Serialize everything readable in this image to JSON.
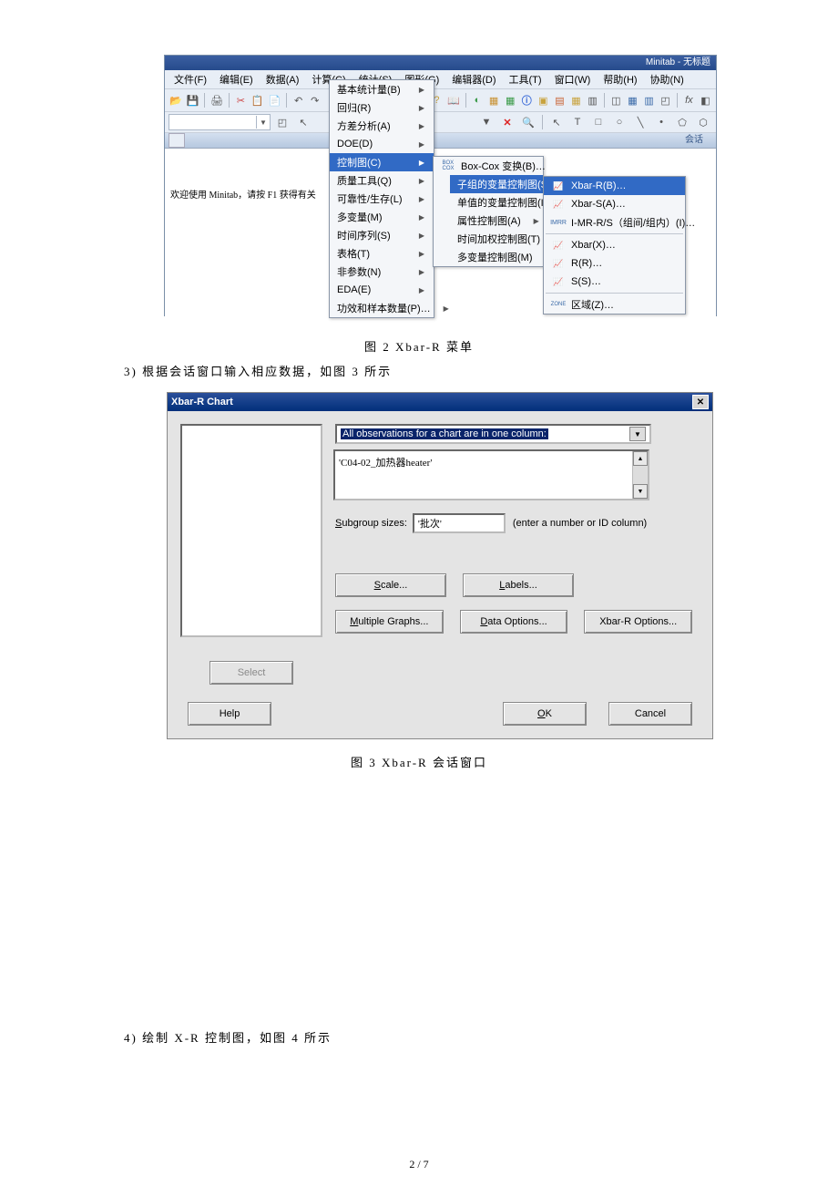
{
  "minitab": {
    "title": "Minitab - 无标题",
    "menubar": [
      "文件(F)",
      "编辑(E)",
      "数据(A)",
      "计算(C)",
      "统计(S)",
      "图形(G)",
      "编辑器(D)",
      "工具(T)",
      "窗口(W)",
      "帮助(H)",
      "协助(N)"
    ],
    "session_label": "会话",
    "welcome": "欢迎使用 Minitab，请按 F1 获得有关"
  },
  "stat_menu": {
    "items": [
      {
        "label": "基本统计量(B)",
        "arrow": true
      },
      {
        "label": "回归(R)",
        "arrow": true
      },
      {
        "label": "方差分析(A)",
        "arrow": true
      },
      {
        "label": "DOE(D)",
        "arrow": true
      },
      {
        "label": "控制图(C)",
        "arrow": true,
        "hl": true
      },
      {
        "label": "质量工具(Q)",
        "arrow": true
      },
      {
        "label": "可靠性/生存(L)",
        "arrow": true
      },
      {
        "label": "多变量(M)",
        "arrow": true
      },
      {
        "label": "时间序列(S)",
        "arrow": true
      },
      {
        "label": "表格(T)",
        "arrow": true
      },
      {
        "label": "非参数(N)",
        "arrow": true
      },
      {
        "label": "EDA(E)",
        "arrow": true
      },
      {
        "label": "功效和样本数量(P)…",
        "arrow": true
      }
    ]
  },
  "ctrl_menu": {
    "items": [
      {
        "icon": "BOX/COX",
        "label": "Box-Cox 变换(B)…"
      },
      {
        "label": "子组的变量控制图(S)",
        "arrow": true,
        "hl": true
      },
      {
        "label": "单值的变量控制图(I)",
        "arrow": true
      },
      {
        "label": "属性控制图(A)",
        "arrow": true
      },
      {
        "label": "时间加权控制图(T)",
        "arrow": true
      },
      {
        "label": "多变量控制图(M)",
        "arrow": true
      }
    ]
  },
  "xbar_menu": {
    "items": [
      {
        "icon": "x̄r",
        "label": "Xbar-R(B)…",
        "hl": true
      },
      {
        "icon": "x̄s",
        "label": "Xbar-S(A)…"
      },
      {
        "icon": "imr",
        "label": "I-MR-R/S（组间/组内）(I)…"
      },
      {
        "sep": true
      },
      {
        "icon": "x̄",
        "label": "Xbar(X)…"
      },
      {
        "icon": "R",
        "label": "R(R)…"
      },
      {
        "icon": "S",
        "label": "S(S)…"
      },
      {
        "sep": true
      },
      {
        "icon": "zone",
        "label": "区域(Z)…"
      }
    ]
  },
  "caption1": "图 2  Xbar-R 菜单",
  "para1": "3)  根据会话窗口输入相应数据，如图 3 所示",
  "dialog": {
    "title": "Xbar-R Chart",
    "select_label": "All observations for a chart are in one column:",
    "textarea": "'C04-02_加热器heater'",
    "subgroup_label": "Subgroup sizes:",
    "subgroup_value": "'批次'",
    "subgroup_hint": "(enter a number or ID column)",
    "btn_scale": "Scale...",
    "btn_labels": "Labels...",
    "btn_multi": "Multiple Graphs...",
    "btn_dataopt": "Data Options...",
    "btn_xbaropt": "Xbar-R Options...",
    "btn_select": "Select",
    "btn_help": "Help",
    "btn_ok": "OK",
    "btn_cancel": "Cancel"
  },
  "caption2": "图 3  Xbar-R 会话窗口",
  "para2": "4)  绘制 X-R 控制图，如图 4 所示",
  "pagenum": "2 / 7"
}
